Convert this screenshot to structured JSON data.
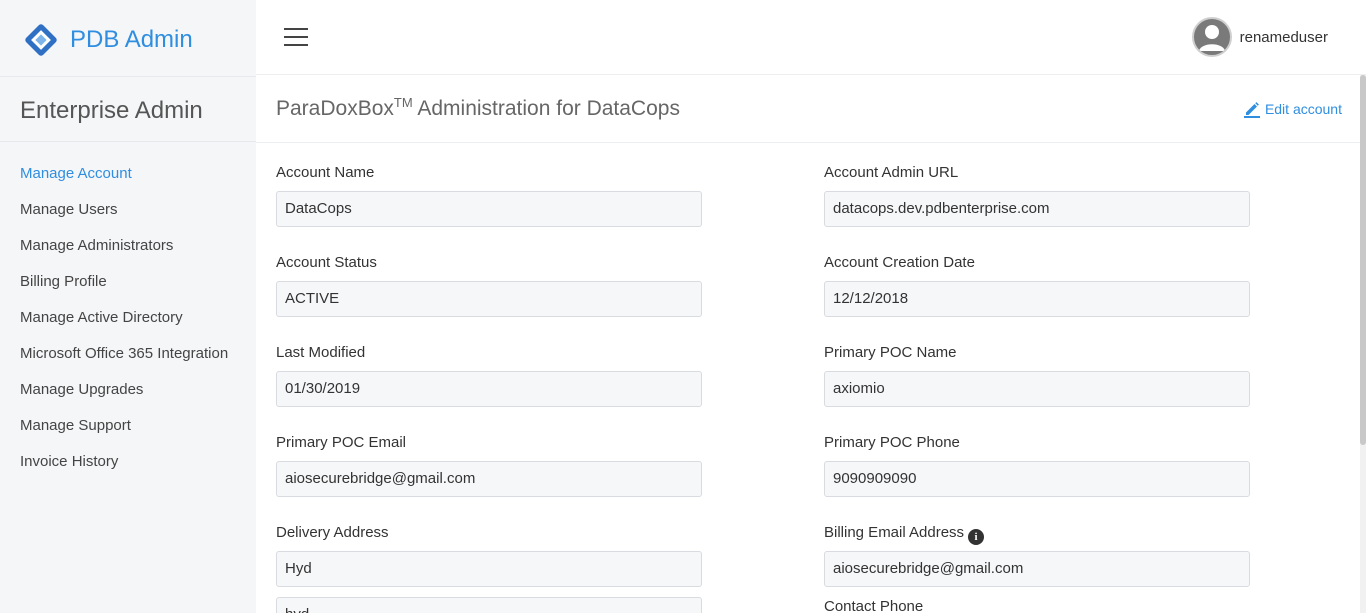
{
  "app": {
    "brand_name": "PDB Admin",
    "brand_color": "#2f8ee0"
  },
  "sidebar": {
    "heading": "Enterprise Admin",
    "items": [
      {
        "label": "Manage Account",
        "active": true
      },
      {
        "label": "Manage Users"
      },
      {
        "label": "Manage Administrators"
      },
      {
        "label": "Billing Profile"
      },
      {
        "label": "Manage Active Directory"
      },
      {
        "label": "Microsoft Office 365 Integration"
      },
      {
        "label": "Manage Upgrades"
      },
      {
        "label": "Manage Support"
      },
      {
        "label": "Invoice History"
      }
    ]
  },
  "topbar": {
    "menu_icon": "hamburger-menu-icon",
    "username": "renameduser",
    "avatar_icon": "user-avatar-icon"
  },
  "page": {
    "title_main": "ParaDoxBox",
    "title_sup": "TM",
    "title_rest": " Administration for DataCops",
    "edit_label": "Edit account",
    "edit_icon": "pencil-icon"
  },
  "form": {
    "fields": [
      {
        "label": "Account Name",
        "value": "DataCops"
      },
      {
        "label": "Account Admin URL",
        "value": "datacops.dev.pdbenterprise.com"
      },
      {
        "label": "Account Status",
        "value": "ACTIVE"
      },
      {
        "label": "Account Creation Date",
        "value": "12/12/2018"
      },
      {
        "label": "Last Modified",
        "value": "01/30/2019"
      },
      {
        "label": "Primary POC Name",
        "value": "axiomio"
      },
      {
        "label": "Primary POC Email",
        "value": "aiosecurebridge@gmail.com"
      },
      {
        "label": "Primary POC Phone",
        "value": "9090909090"
      },
      {
        "label": "Delivery Address",
        "value": "Hyd"
      },
      {
        "label": "Billing Email Address",
        "value": "aiosecurebridge@gmail.com",
        "info_icon": "i"
      },
      {
        "label": "",
        "value": "hyd"
      },
      {
        "label": "Contact Phone",
        "value": ""
      }
    ]
  }
}
